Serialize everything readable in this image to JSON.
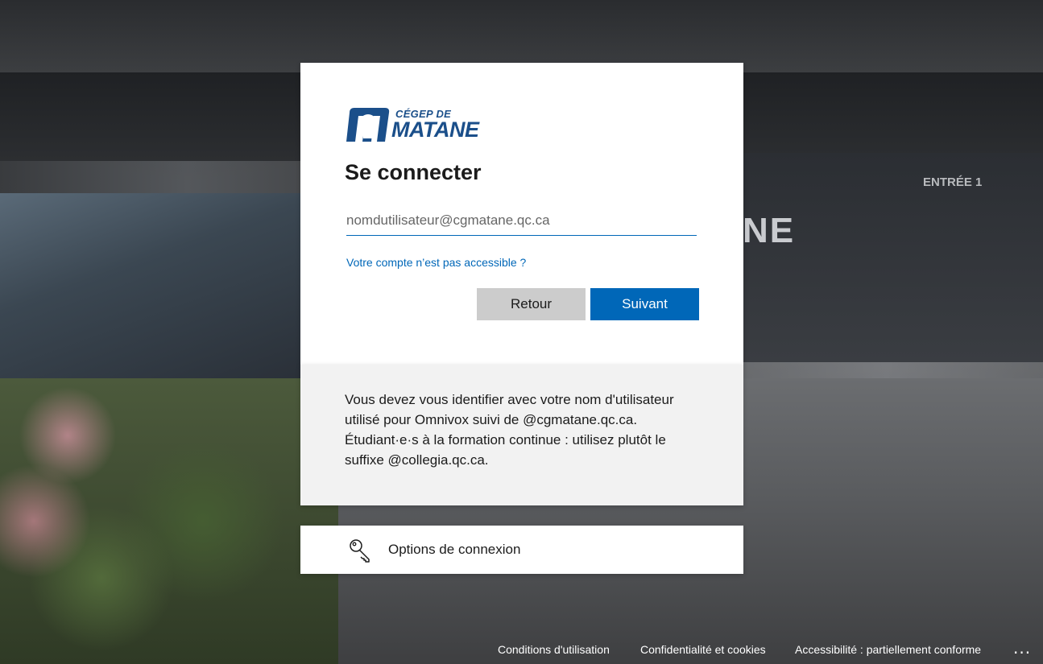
{
  "logo": {
    "line1": "CÉGEP DE",
    "line2": "MATANE",
    "brand_color": "#1b4f8a"
  },
  "background": {
    "sign_text": "NE",
    "entrance_text": "ENTRÉE 1"
  },
  "signin": {
    "title": "Se connecter",
    "email_placeholder": "nomdutilisateur@cgmatane.qc.ca",
    "email_value": "",
    "account_link": "Votre compte n’est pas accessible ?",
    "back_label": "Retour",
    "next_label": "Suivant",
    "accent_color": "#0067b8"
  },
  "info": {
    "text": "Vous devez vous identifier avec votre nom d'utilisateur utilisé pour Omnivox suivi de @cgmatane.qc.ca. Étudiant·e·s à la formation continue : utilisez plutôt le suffixe @collegia.qc.ca."
  },
  "options": {
    "icon": "key-icon",
    "label": "Options de connexion"
  },
  "footer": {
    "terms": "Conditions d'utilisation",
    "privacy": "Confidentialité et cookies",
    "accessibility": "Accessibilité : partiellement conforme",
    "more": "..."
  }
}
